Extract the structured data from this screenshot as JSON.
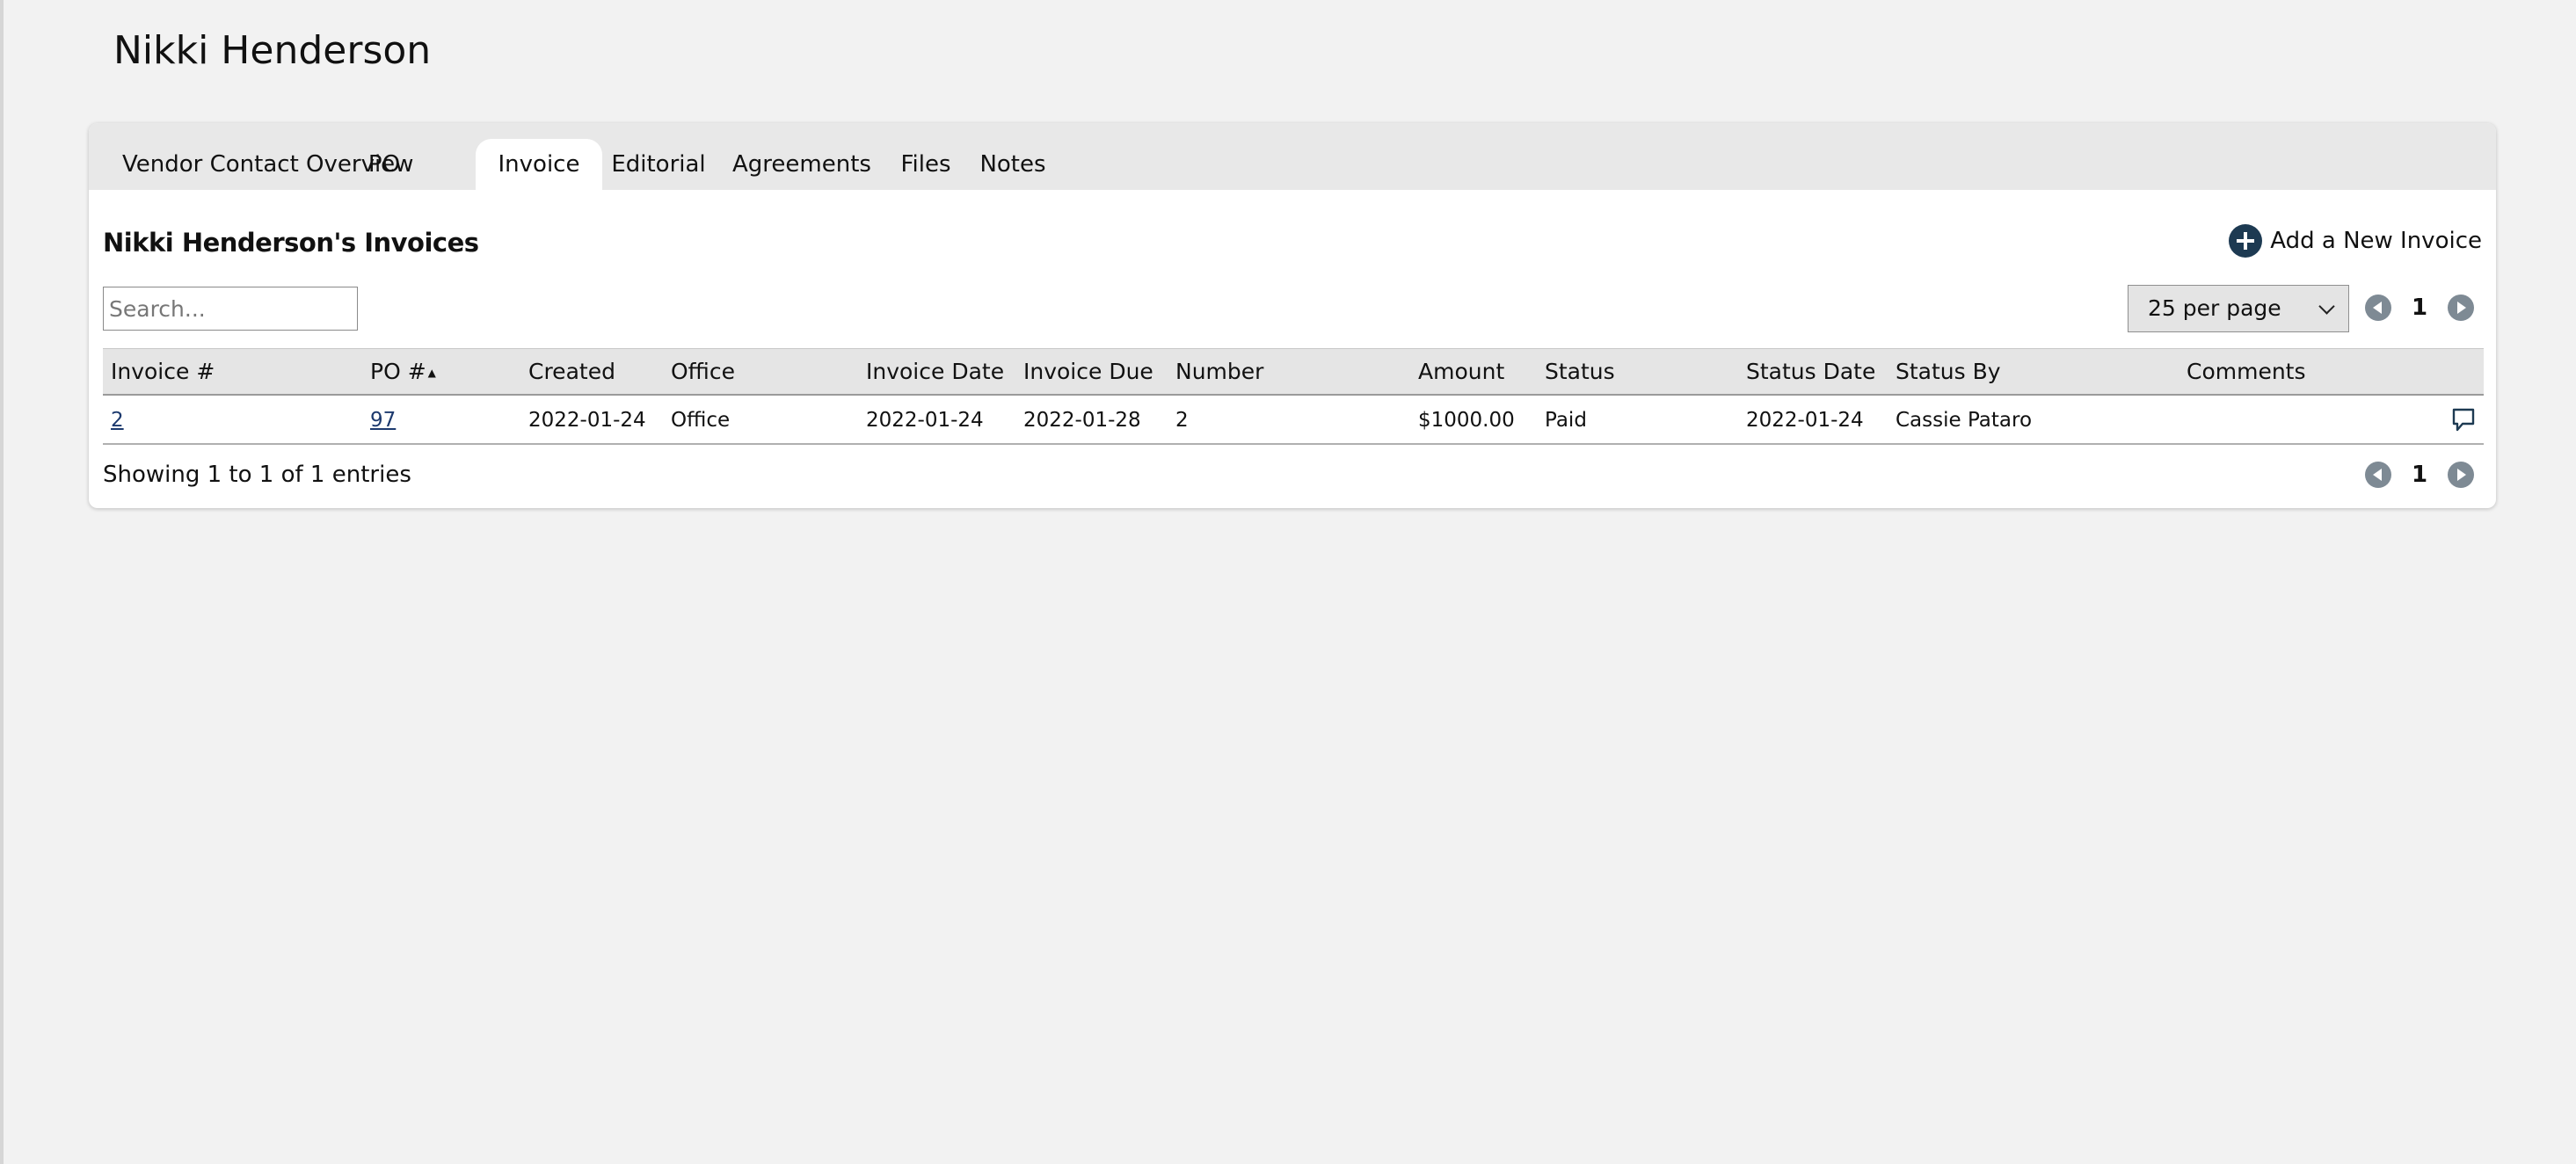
{
  "page_title": "Nikki Henderson",
  "tabs": [
    {
      "label": "Vendor Contact Overview",
      "active": false
    },
    {
      "label": "PO",
      "active": false
    },
    {
      "label": "Invoice",
      "active": true
    },
    {
      "label": "Editorial",
      "active": false
    },
    {
      "label": "Agreements",
      "active": false
    },
    {
      "label": "Files",
      "active": false
    },
    {
      "label": "Notes",
      "active": false
    }
  ],
  "section_title": "Nikki Henderson's Invoices",
  "add_button_label": "Add a New Invoice",
  "search": {
    "placeholder": "Search...",
    "value": ""
  },
  "per_page": {
    "selected": "25 per page"
  },
  "pagination": {
    "current_page": "1"
  },
  "table": {
    "columns": [
      "Invoice #",
      "PO #",
      "Created",
      "Office",
      "Invoice Date",
      "Invoice Due",
      "Number",
      "Amount",
      "Status",
      "Status Date",
      "Status By",
      "Comments"
    ],
    "sorted_column": "PO #",
    "sort_direction": "ascending",
    "rows": [
      {
        "invoice_no": "2",
        "po_no": "97",
        "created": "2022-01-24",
        "office": "Office",
        "invoice_date": "2022-01-24",
        "invoice_due": "2022-01-28",
        "number": "2",
        "amount": "$1000.00",
        "status": "Paid",
        "status_date": "2022-01-24",
        "status_by": "Cassie Pataro",
        "comments": ""
      }
    ]
  },
  "footer": {
    "showing_text": "Showing 1 to 1 of 1 entries"
  },
  "colors": {
    "accent": "#1d3a52",
    "link": "#1d3a6e",
    "pager_button": "#7e8a94",
    "tab_bar": "#e8e8e8",
    "page_background": "#f2f2f2"
  },
  "icons": {
    "add": "plus-circle-icon",
    "prev": "chevron-left-icon",
    "next": "chevron-right-icon",
    "comment": "comment-icon",
    "dropdown": "chevron-down-icon"
  }
}
